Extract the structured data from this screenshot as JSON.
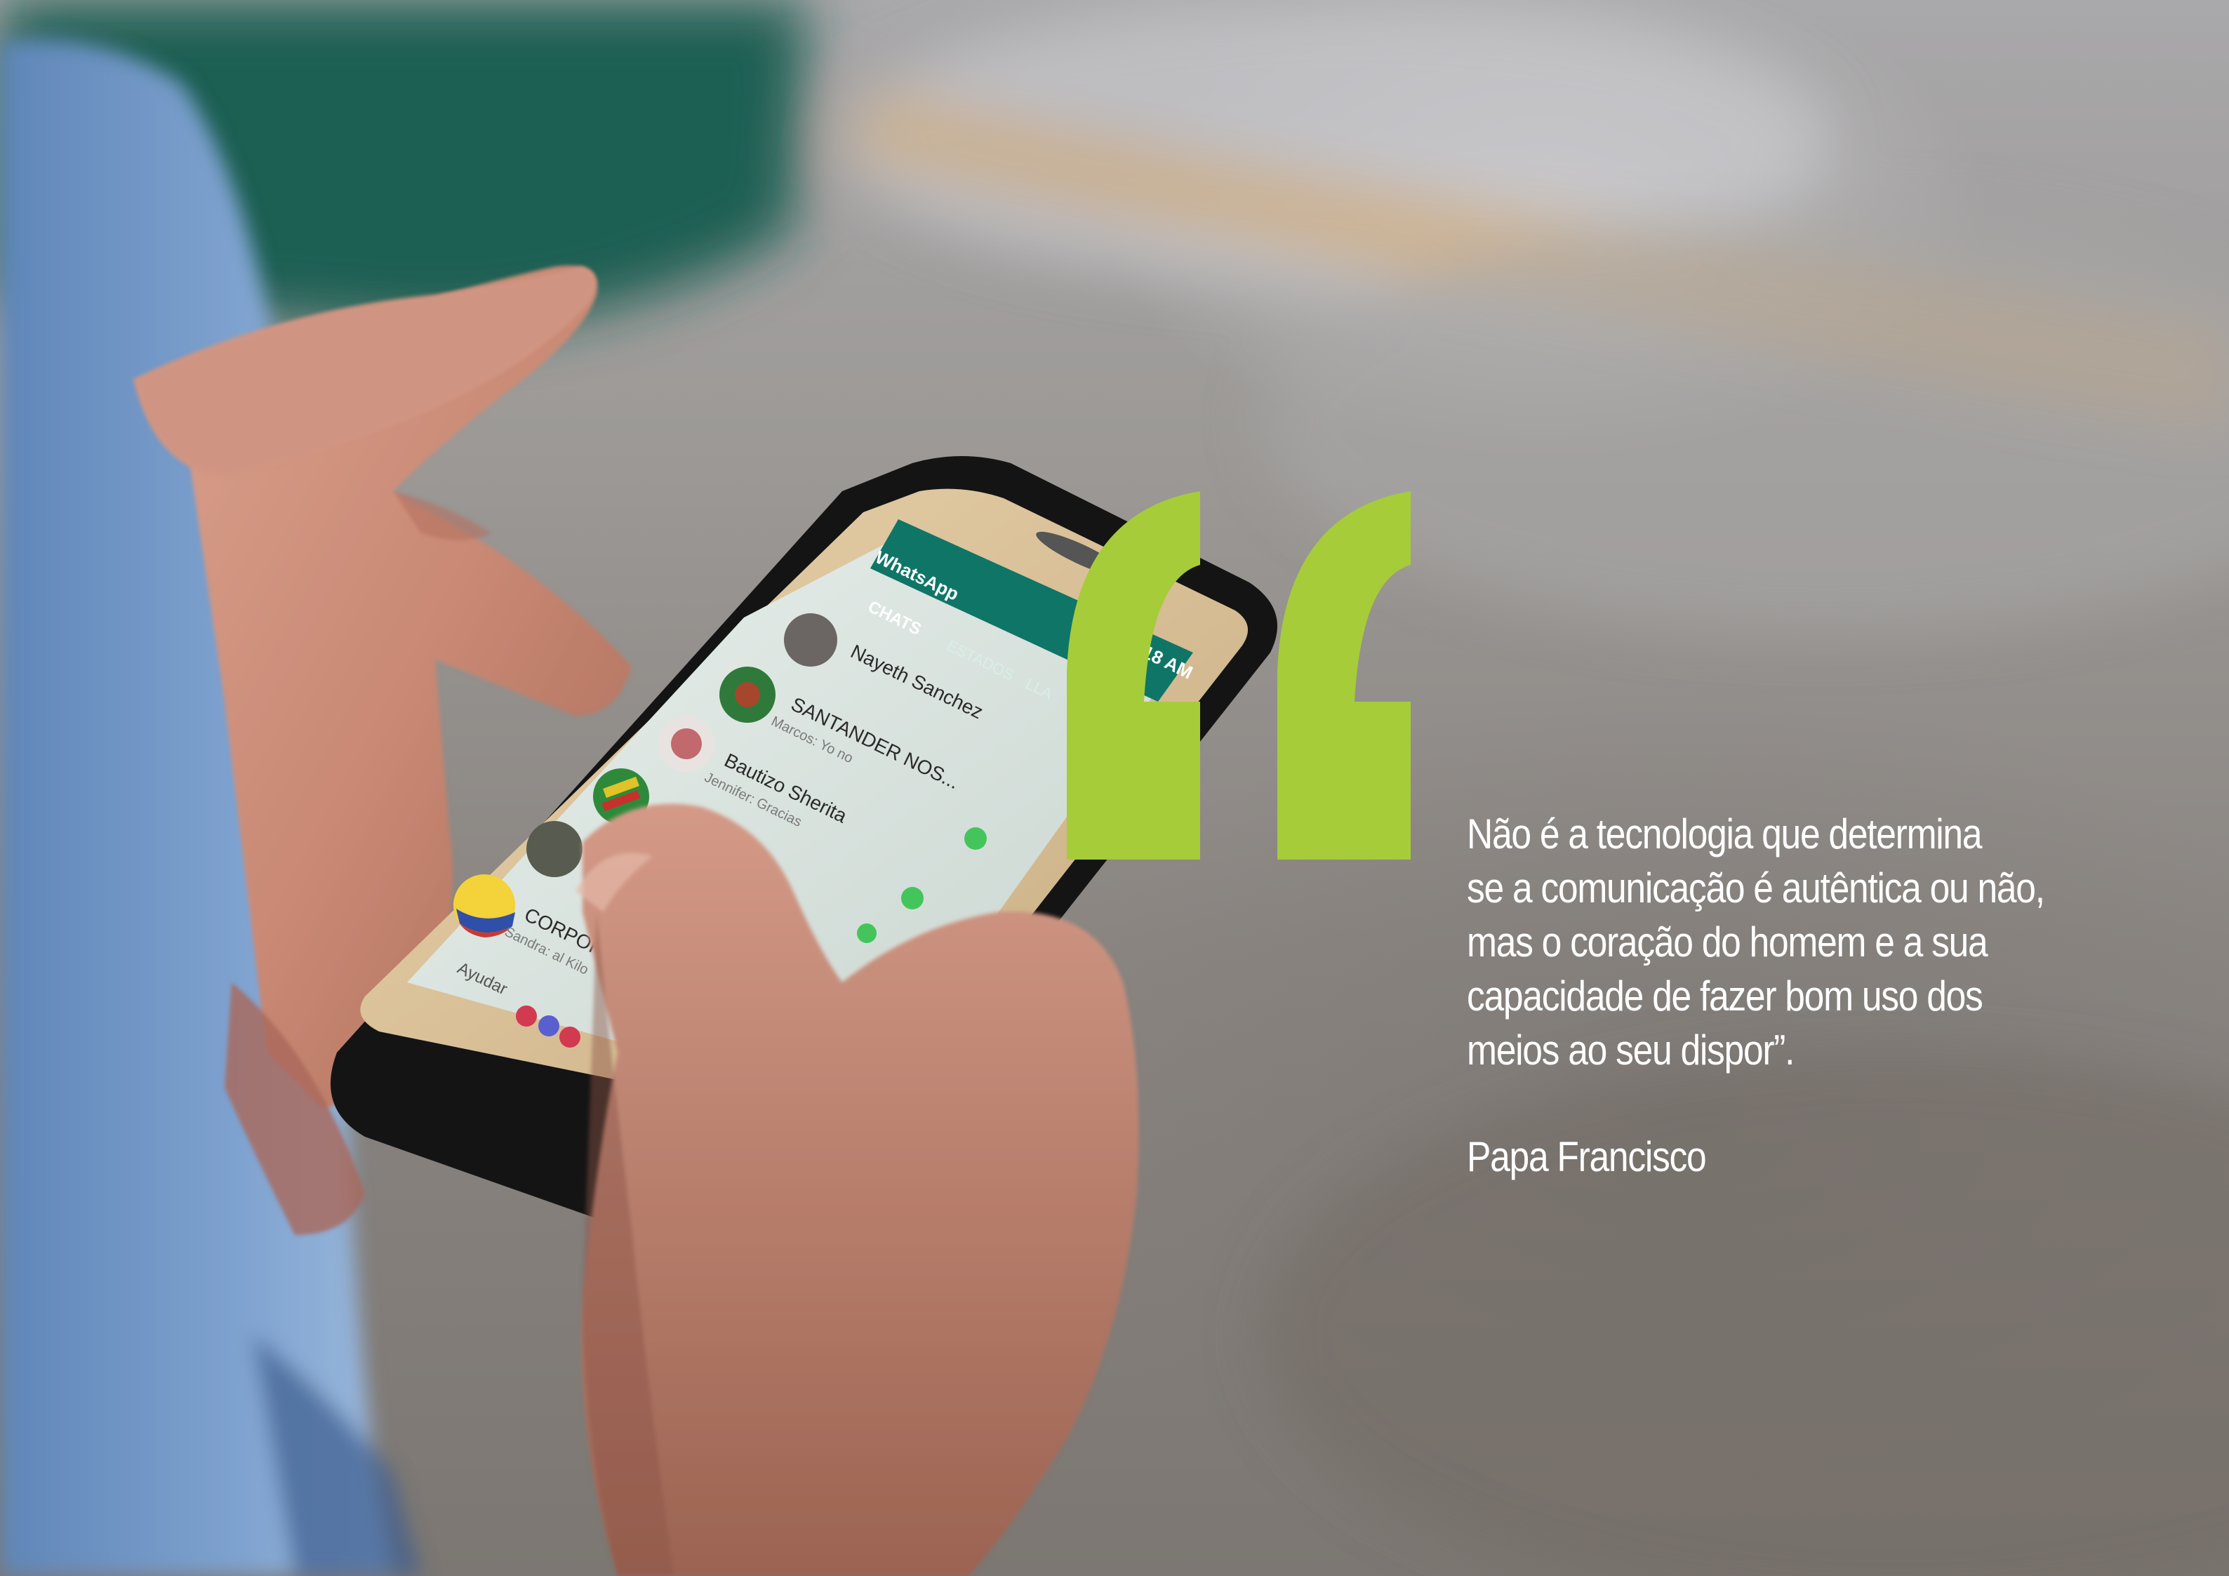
{
  "quote": {
    "lines": [
      "Não é a tecnologia que determina",
      "se a comunicação é autêntica ou não,",
      "mas o coração do homem e a sua",
      "capacidade de fazer bom uso dos",
      "meios ao seu dispor”."
    ],
    "author": "Papa Francisco"
  },
  "phone_screen": {
    "app_title": "WhatsApp",
    "tabs": [
      "CHATS",
      "ESTADOS",
      "LLA"
    ],
    "time": "3:18 AM",
    "chats": [
      {
        "name": "Nayeth Sanchez",
        "preview": ""
      },
      {
        "name": "SANTANDER NOS...",
        "preview": "Marcos: Yo no"
      },
      {
        "name": "Bautizo Sherita",
        "preview": "Jennifer: Gracias"
      },
      {
        "name": "CORPORACIÓN",
        "preview": "Sandra: al Kilo"
      }
    ],
    "footer_text": "Ayudar"
  },
  "colors": {
    "accent_green": "#a6cc3a",
    "whatsapp_green": "#0f7567",
    "quote_text": "#ffffff"
  }
}
